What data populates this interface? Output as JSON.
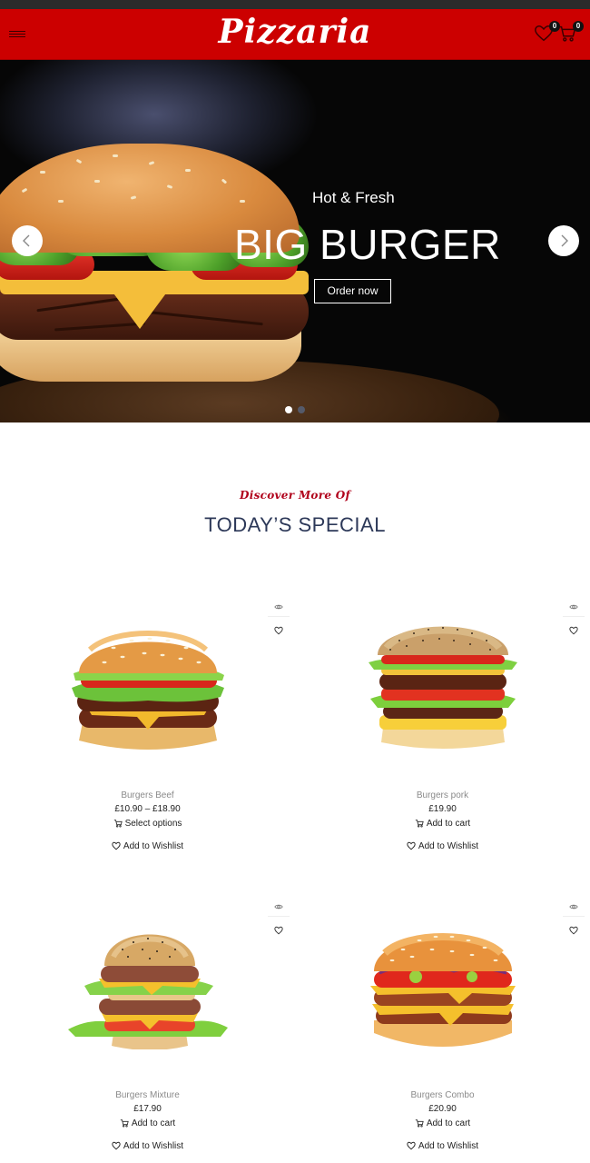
{
  "header": {
    "logo_text": "Pizzaria",
    "wishlist_count": "0",
    "cart_count": "0"
  },
  "hero": {
    "subtitle": "Hot & Fresh",
    "title": "BIG BURGER",
    "button_label": "Order now",
    "slide_count": 2,
    "active_slide": 1
  },
  "section": {
    "kicker": "Discover More Of",
    "title": "TODAY’S SPECIAL"
  },
  "products": [
    {
      "name": "Burgers Beef",
      "price": "£10.90 – £18.90",
      "action": "Select options",
      "wishlist": "Add to Wishlist"
    },
    {
      "name": "Burgers pork",
      "price": "£19.90",
      "action": "Add to cart",
      "wishlist": "Add to Wishlist"
    },
    {
      "name": "Burgers Mixture",
      "price": "£17.90",
      "action": "Add to cart",
      "wishlist": "Add to Wishlist"
    },
    {
      "name": "Burgers Combo",
      "price": "£20.90",
      "action": "Add to cart",
      "wishlist": "Add to Wishlist"
    }
  ],
  "colors": {
    "brand_red": "#cc0000",
    "section_title": "#2c3858",
    "kicker_red": "#b0001a"
  }
}
